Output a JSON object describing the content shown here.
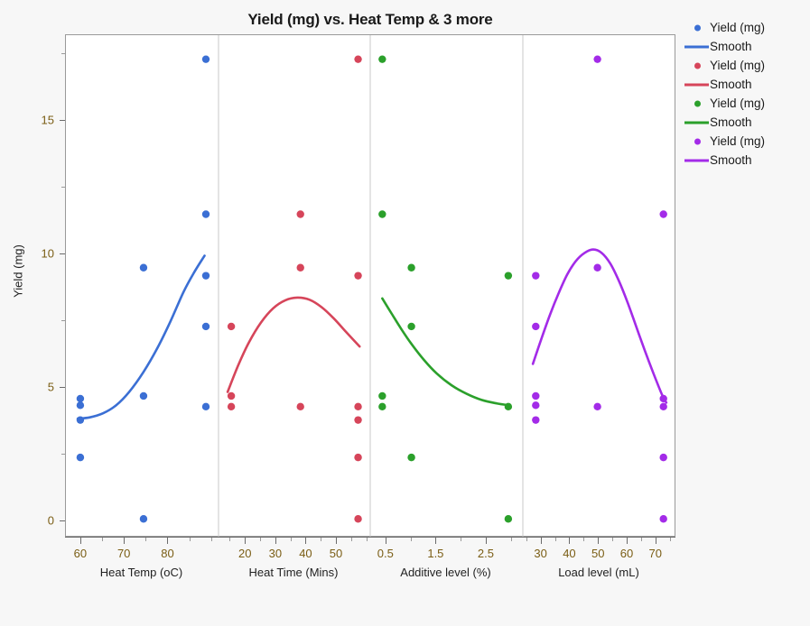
{
  "chart": {
    "title": "Yield (mg) vs. Heat Temp & 3 more",
    "y_axis_title": "Yield (mg)"
  },
  "legend": {
    "items": [
      {
        "label": "Yield (mg)",
        "type": "dot",
        "color": "#3b6fd4"
      },
      {
        "label": "Smooth",
        "type": "line",
        "color": "#3b6fd4"
      },
      {
        "label": "Yield (mg)",
        "type": "dot",
        "color": "#d6455a"
      },
      {
        "label": "Smooth",
        "type": "line",
        "color": "#d6455a"
      },
      {
        "label": "Yield (mg)",
        "type": "dot",
        "color": "#2ba02b"
      },
      {
        "label": "Smooth",
        "type": "line",
        "color": "#2ba02b"
      },
      {
        "label": "Yield (mg)",
        "type": "dot",
        "color": "#a32be8"
      },
      {
        "label": "Smooth",
        "type": "line",
        "color": "#a32be8"
      }
    ]
  },
  "chart_data": {
    "type": "scatter",
    "title": "Yield (mg) vs. Heat Temp & 3 more",
    "ylabel": "Yield (mg)",
    "ylim": [
      -0.6,
      18.2
    ],
    "yticks": [
      0,
      5,
      10,
      15
    ],
    "yticks_minor": [
      2.5,
      7.5,
      12.5,
      17.5
    ],
    "grid": false,
    "legend_position": "right",
    "panels": [
      {
        "xlabel": "Heat Temp (oC)",
        "color": "#3b6fd4",
        "xlim": [
          56.5,
          91.5
        ],
        "xticks": [
          60,
          70,
          80
        ],
        "xticks_minor": [
          65,
          75,
          85,
          90
        ],
        "points": [
          {
            "x": 59.8,
            "y": 4.6
          },
          {
            "x": 59.8,
            "y": 4.35
          },
          {
            "x": 59.8,
            "y": 3.8
          },
          {
            "x": 59.8,
            "y": 2.4
          },
          {
            "x": 74.3,
            "y": 9.5
          },
          {
            "x": 74.3,
            "y": 4.7
          },
          {
            "x": 74.3,
            "y": 0.1
          },
          {
            "x": 88.6,
            "y": 17.3
          },
          {
            "x": 88.6,
            "y": 11.5
          },
          {
            "x": 88.6,
            "y": 9.2
          },
          {
            "x": 88.6,
            "y": 7.3
          },
          {
            "x": 88.6,
            "y": 4.3
          }
        ],
        "smooth": [
          {
            "x": 59.2,
            "y": 3.85
          },
          {
            "x": 62.0,
            "y": 3.9
          },
          {
            "x": 65.0,
            "y": 4.05
          },
          {
            "x": 68.0,
            "y": 4.35
          },
          {
            "x": 71.0,
            "y": 4.85
          },
          {
            "x": 74.3,
            "y": 5.6
          },
          {
            "x": 77.5,
            "y": 6.5
          },
          {
            "x": 80.5,
            "y": 7.5
          },
          {
            "x": 83.5,
            "y": 8.6
          },
          {
            "x": 86.0,
            "y": 9.35
          },
          {
            "x": 88.3,
            "y": 9.95
          }
        ]
      },
      {
        "xlabel": "Heat Time (Mins)",
        "color": "#d6455a",
        "xlim": [
          11.0,
          61.0
        ],
        "xticks": [
          20,
          30,
          40,
          50
        ],
        "xticks_minor": [
          15,
          25,
          35,
          45,
          55,
          60
        ],
        "points": [
          {
            "x": 15.2,
            "y": 7.3
          },
          {
            "x": 15.2,
            "y": 4.7
          },
          {
            "x": 15.2,
            "y": 4.3
          },
          {
            "x": 38.0,
            "y": 11.5
          },
          {
            "x": 38.0,
            "y": 9.5
          },
          {
            "x": 38.0,
            "y": 4.3
          },
          {
            "x": 57.0,
            "y": 17.3
          },
          {
            "x": 57.0,
            "y": 9.2
          },
          {
            "x": 57.0,
            "y": 4.3
          },
          {
            "x": 57.0,
            "y": 3.8
          },
          {
            "x": 57.0,
            "y": 2.4
          },
          {
            "x": 57.0,
            "y": 0.1
          }
        ],
        "smooth": [
          {
            "x": 14.0,
            "y": 4.85
          },
          {
            "x": 17.5,
            "y": 5.85
          },
          {
            "x": 21.0,
            "y": 6.7
          },
          {
            "x": 25.0,
            "y": 7.45
          },
          {
            "x": 29.0,
            "y": 7.98
          },
          {
            "x": 33.0,
            "y": 8.28
          },
          {
            "x": 37.0,
            "y": 8.38
          },
          {
            "x": 41.0,
            "y": 8.3
          },
          {
            "x": 45.0,
            "y": 8.02
          },
          {
            "x": 49.0,
            "y": 7.6
          },
          {
            "x": 53.0,
            "y": 7.1
          },
          {
            "x": 57.5,
            "y": 6.55
          }
        ]
      },
      {
        "xlabel": "Additive level (%)",
        "color": "#2ba02b",
        "xlim": [
          0.18,
          3.22
        ],
        "xticks": [
          0.5,
          1.5,
          2.5
        ],
        "xticks_minor": [
          1.0,
          2.0,
          3.0
        ],
        "points": [
          {
            "x": 0.42,
            "y": 17.3
          },
          {
            "x": 0.42,
            "y": 11.5
          },
          {
            "x": 0.42,
            "y": 4.7
          },
          {
            "x": 0.42,
            "y": 4.3
          },
          {
            "x": 1.0,
            "y": 9.5
          },
          {
            "x": 1.0,
            "y": 7.3
          },
          {
            "x": 1.0,
            "y": 2.4
          },
          {
            "x": 2.93,
            "y": 9.2
          },
          {
            "x": 2.93,
            "y": 4.3
          },
          {
            "x": 2.93,
            "y": 0.1
          }
        ],
        "smooth": [
          {
            "x": 0.42,
            "y": 8.35
          },
          {
            "x": 0.6,
            "y": 7.8
          },
          {
            "x": 0.8,
            "y": 7.2
          },
          {
            "x": 1.0,
            "y": 6.65
          },
          {
            "x": 1.25,
            "y": 6.05
          },
          {
            "x": 1.5,
            "y": 5.55
          },
          {
            "x": 1.8,
            "y": 5.1
          },
          {
            "x": 2.1,
            "y": 4.78
          },
          {
            "x": 2.4,
            "y": 4.55
          },
          {
            "x": 2.7,
            "y": 4.42
          },
          {
            "x": 2.95,
            "y": 4.35
          }
        ]
      },
      {
        "xlabel": "Load level (mL)",
        "color": "#a32be8",
        "xlim": [
          23.5,
          77.0
        ],
        "xticks": [
          30,
          40,
          50,
          60,
          70
        ],
        "xticks_minor": [
          25,
          35,
          45,
          55,
          65,
          75
        ],
        "points": [
          {
            "x": 28.0,
            "y": 9.2
          },
          {
            "x": 28.0,
            "y": 7.3
          },
          {
            "x": 28.0,
            "y": 4.7
          },
          {
            "x": 28.0,
            "y": 4.35
          },
          {
            "x": 28.0,
            "y": 3.8
          },
          {
            "x": 49.5,
            "y": 17.3
          },
          {
            "x": 49.5,
            "y": 9.5
          },
          {
            "x": 49.5,
            "y": 4.3
          },
          {
            "x": 72.5,
            "y": 11.5
          },
          {
            "x": 72.5,
            "y": 4.6
          },
          {
            "x": 72.5,
            "y": 4.3
          },
          {
            "x": 72.5,
            "y": 2.4
          },
          {
            "x": 72.5,
            "y": 0.1
          }
        ],
        "smooth": [
          {
            "x": 27.0,
            "y": 5.9
          },
          {
            "x": 30.0,
            "y": 6.85
          },
          {
            "x": 33.0,
            "y": 7.75
          },
          {
            "x": 36.0,
            "y": 8.55
          },
          {
            "x": 39.0,
            "y": 9.25
          },
          {
            "x": 42.0,
            "y": 9.75
          },
          {
            "x": 45.0,
            "y": 10.05
          },
          {
            "x": 48.0,
            "y": 10.18
          },
          {
            "x": 51.0,
            "y": 10.05
          },
          {
            "x": 54.0,
            "y": 9.65
          },
          {
            "x": 57.0,
            "y": 9.0
          },
          {
            "x": 60.0,
            "y": 8.2
          },
          {
            "x": 63.0,
            "y": 7.3
          },
          {
            "x": 66.0,
            "y": 6.4
          },
          {
            "x": 69.0,
            "y": 5.55
          },
          {
            "x": 72.0,
            "y": 4.75
          },
          {
            "x": 73.5,
            "y": 4.45
          }
        ]
      }
    ]
  }
}
